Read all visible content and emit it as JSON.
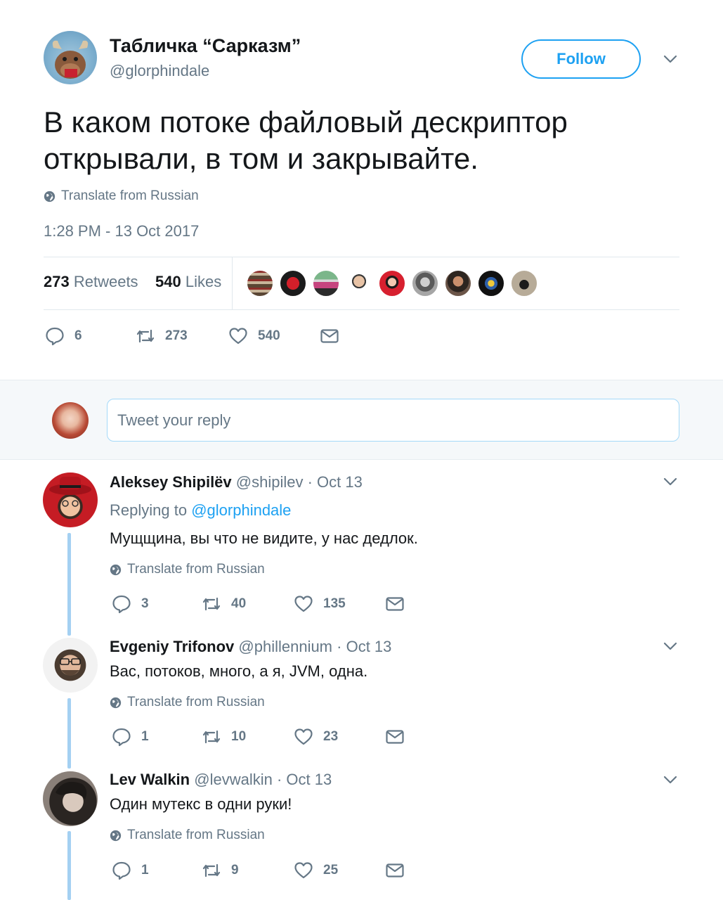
{
  "tweet": {
    "author_name": "Табличка “Сарказм”",
    "author_handle": "@glorphindale",
    "follow_label": "Follow",
    "text_line1": "В каком потоке файловый дескриптор",
    "text_line2": "открывали, в том и закрывайте.",
    "translate_label": "Translate from Russian",
    "timestamp": "1:28 PM - 13 Oct 2017",
    "retweets_count": "273",
    "retweets_label": "Retweets",
    "likes_count": "540",
    "likes_label": "Likes",
    "actions": {
      "replies": "6",
      "retweets": "273",
      "likes": "540"
    }
  },
  "reply_box": {
    "placeholder": "Tweet your reply"
  },
  "replies": [
    {
      "name": "Aleksey Shipilёv",
      "handle": "@shipilev",
      "date": "· Oct 13",
      "replying_prefix": "Replying to",
      "replying_to": "@glorphindale",
      "text": "Мущщина, вы что не видите, у нас дедлок.",
      "translate_label": "Translate from Russian",
      "replies": "3",
      "retweets": "40",
      "likes": "135"
    },
    {
      "name": "Evgeniy Trifonov",
      "handle": "@phillennium",
      "date": "· Oct 13",
      "text": "Вас, потоков, много, а я, JVM, одна.",
      "translate_label": "Translate from Russian",
      "replies": "1",
      "retweets": "10",
      "likes": "23"
    },
    {
      "name": "Lev Walkin",
      "handle": "@levwalkin",
      "date": "· Oct 13",
      "text": "Один мутекс в одни руки!",
      "translate_label": "Translate from Russian",
      "replies": "1",
      "retweets": "9",
      "likes": "25"
    }
  ],
  "colors": {
    "accent": "#1da1f2",
    "muted": "#657786",
    "text": "#14171a",
    "thread": "#a4d0f2"
  }
}
